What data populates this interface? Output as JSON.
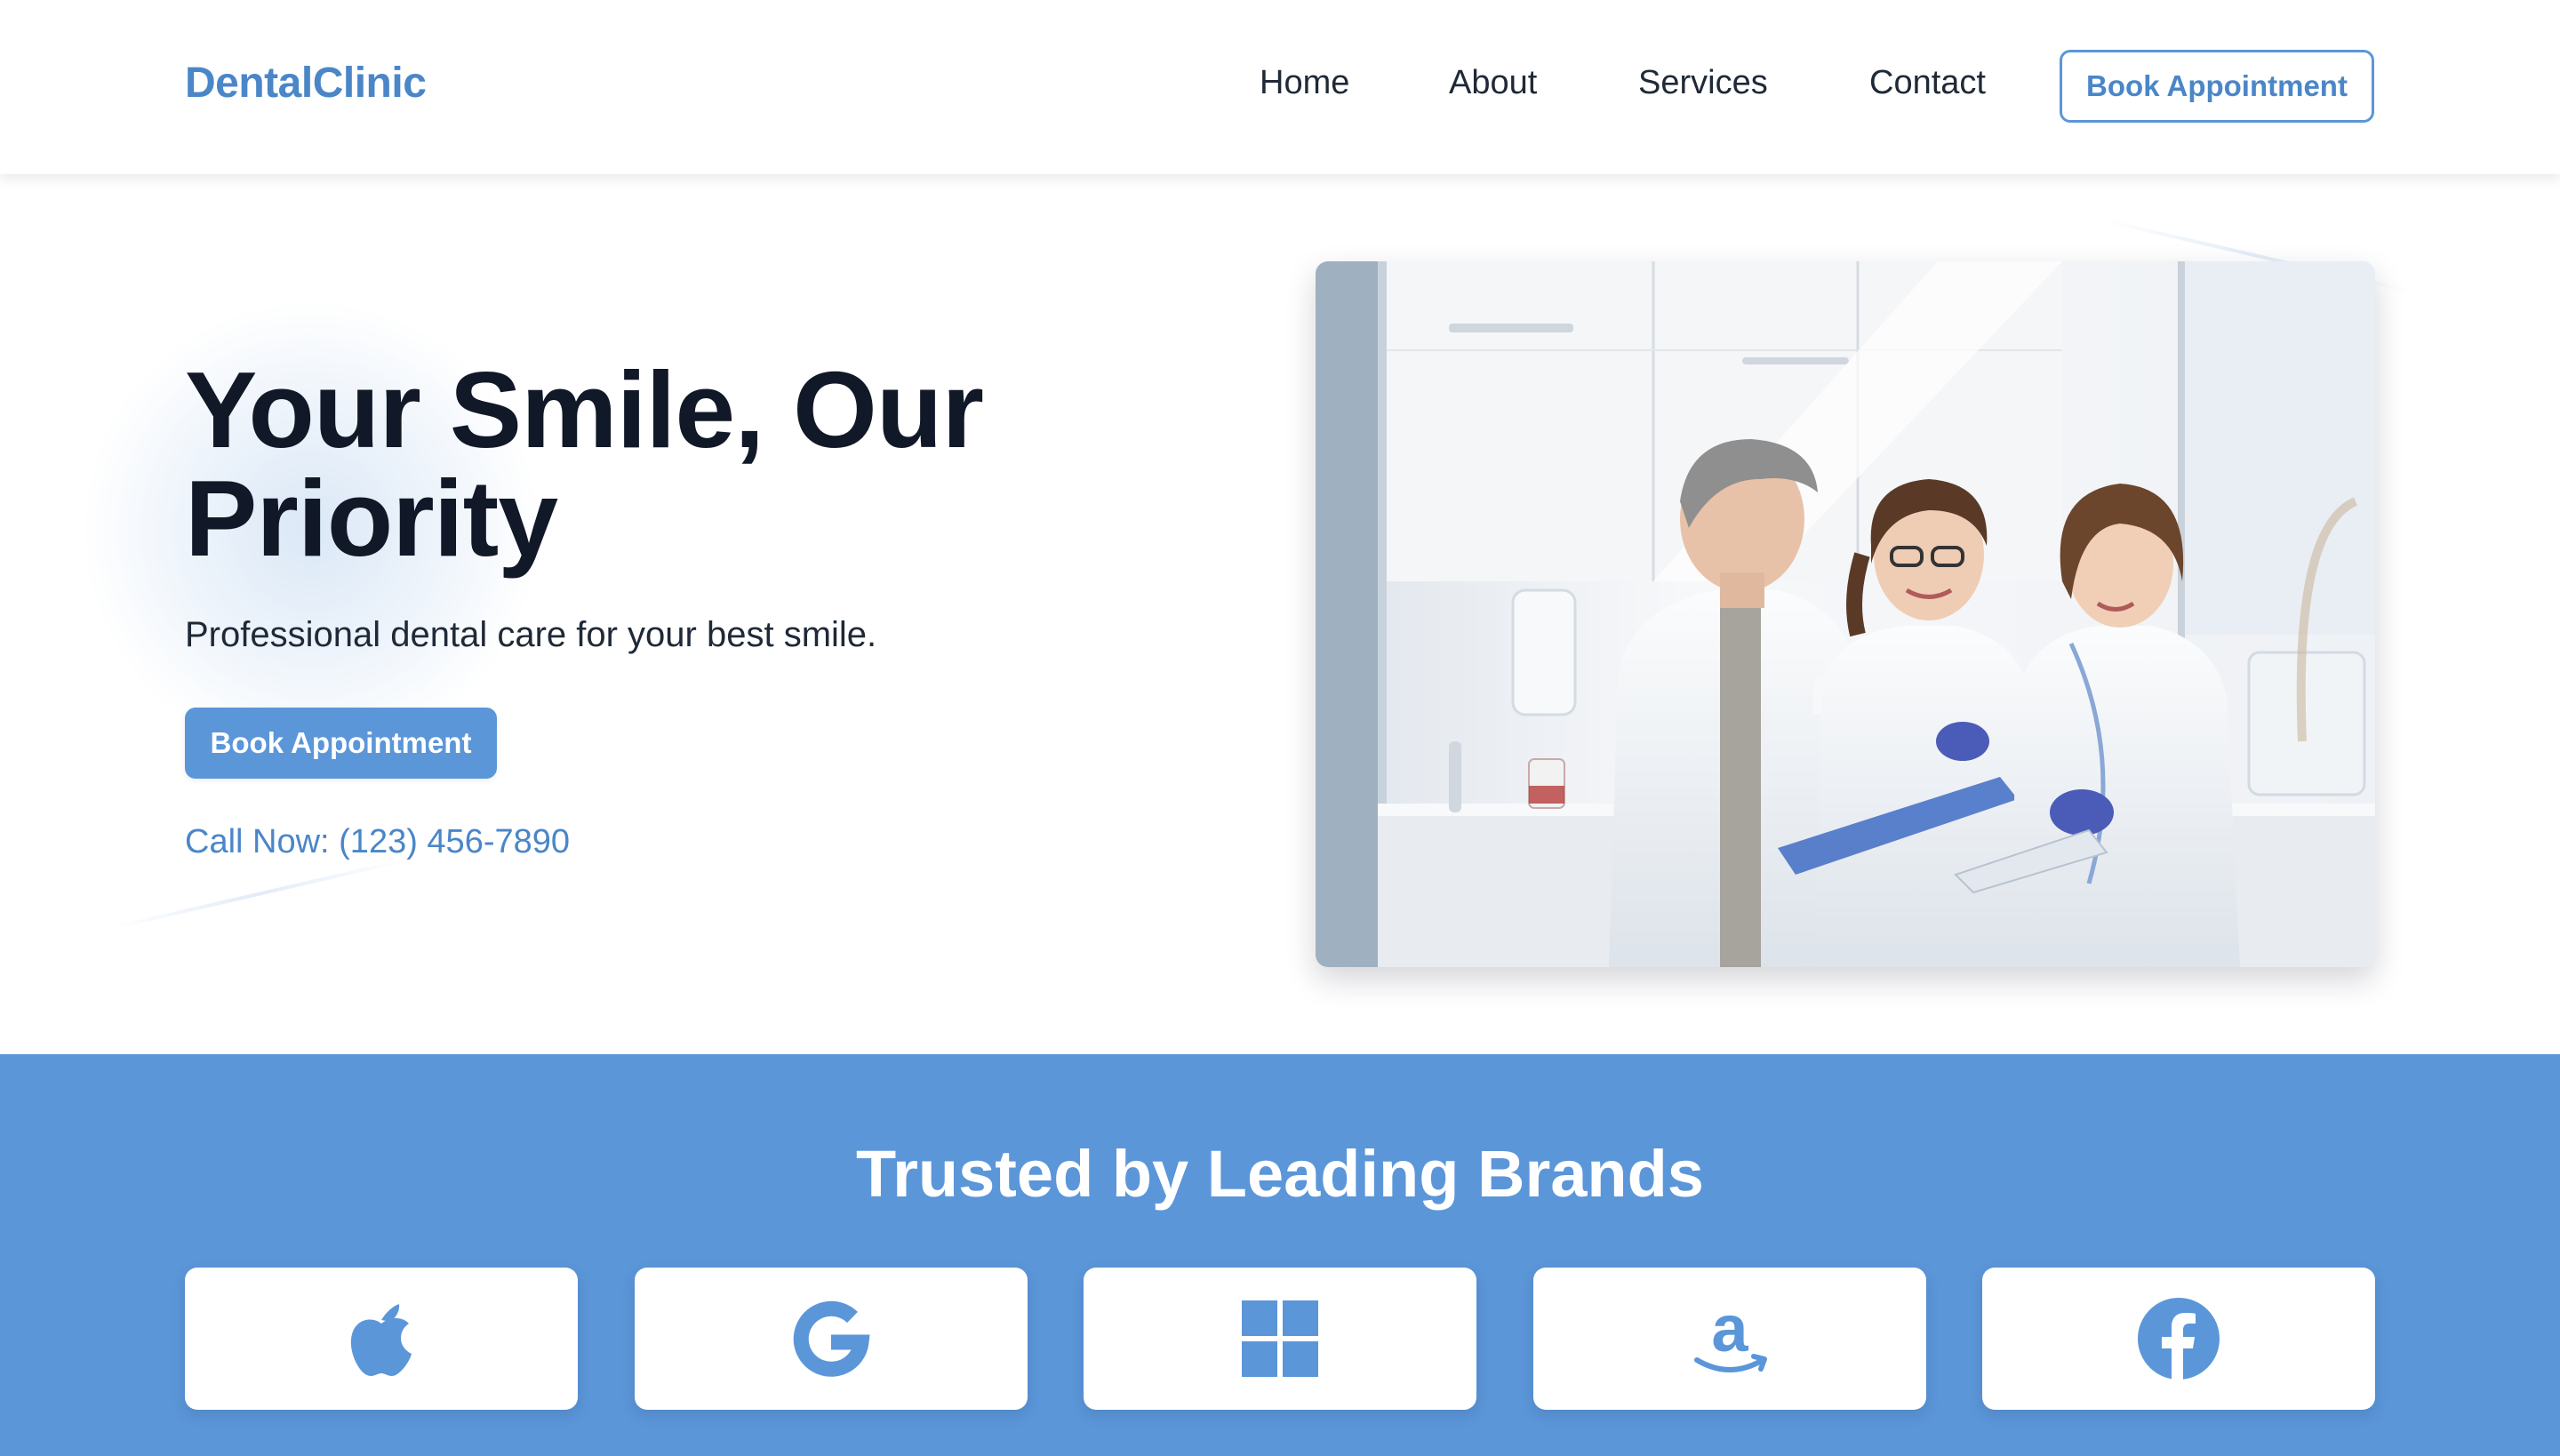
{
  "header": {
    "logo": "DentalClinic",
    "nav": [
      "Home",
      "About",
      "Services",
      "Contact"
    ],
    "cta": "Book Appointment"
  },
  "hero": {
    "title": "Your Smile, Our Priority",
    "subtitle": "Professional dental care for your best smile.",
    "cta": "Book Appointment",
    "phone": "Call Now: (123) 456-7890",
    "image": "photo of three dental professionals in white coats talking in a bright clinic"
  },
  "brands": {
    "title": "Trusted by Leading Brands",
    "logos": [
      "apple-icon",
      "google-icon",
      "windows-icon",
      "amazon-icon",
      "facebook-icon"
    ]
  },
  "colors": {
    "accent": "#5b96d9",
    "logo_text": "#4a86c8",
    "heading": "#111827"
  }
}
